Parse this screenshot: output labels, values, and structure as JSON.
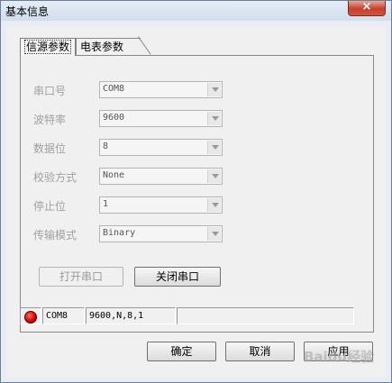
{
  "window": {
    "title": "基本信息",
    "close_label": "×"
  },
  "tabs": [
    {
      "label": "信源参数",
      "active": true
    },
    {
      "label": "电表参数",
      "active": false
    }
  ],
  "fields": [
    {
      "label": "串口号",
      "value": "COM8"
    },
    {
      "label": "波特率",
      "value": "9600"
    },
    {
      "label": "数据位",
      "value": "8"
    },
    {
      "label": "校验方式",
      "value": "None"
    },
    {
      "label": "停止位",
      "value": "1"
    },
    {
      "label": "传输模式",
      "value": "Binary"
    }
  ],
  "buttons": {
    "open_port": "打开串口",
    "close_port": "关闭串口",
    "ok": "确定",
    "cancel": "取消",
    "apply": "应用"
  },
  "status_bar": {
    "port": "COM8",
    "settings": "9600,N,8,1",
    "extra": "",
    "led_color": "#d10000"
  },
  "watermark": "Baidu经验"
}
